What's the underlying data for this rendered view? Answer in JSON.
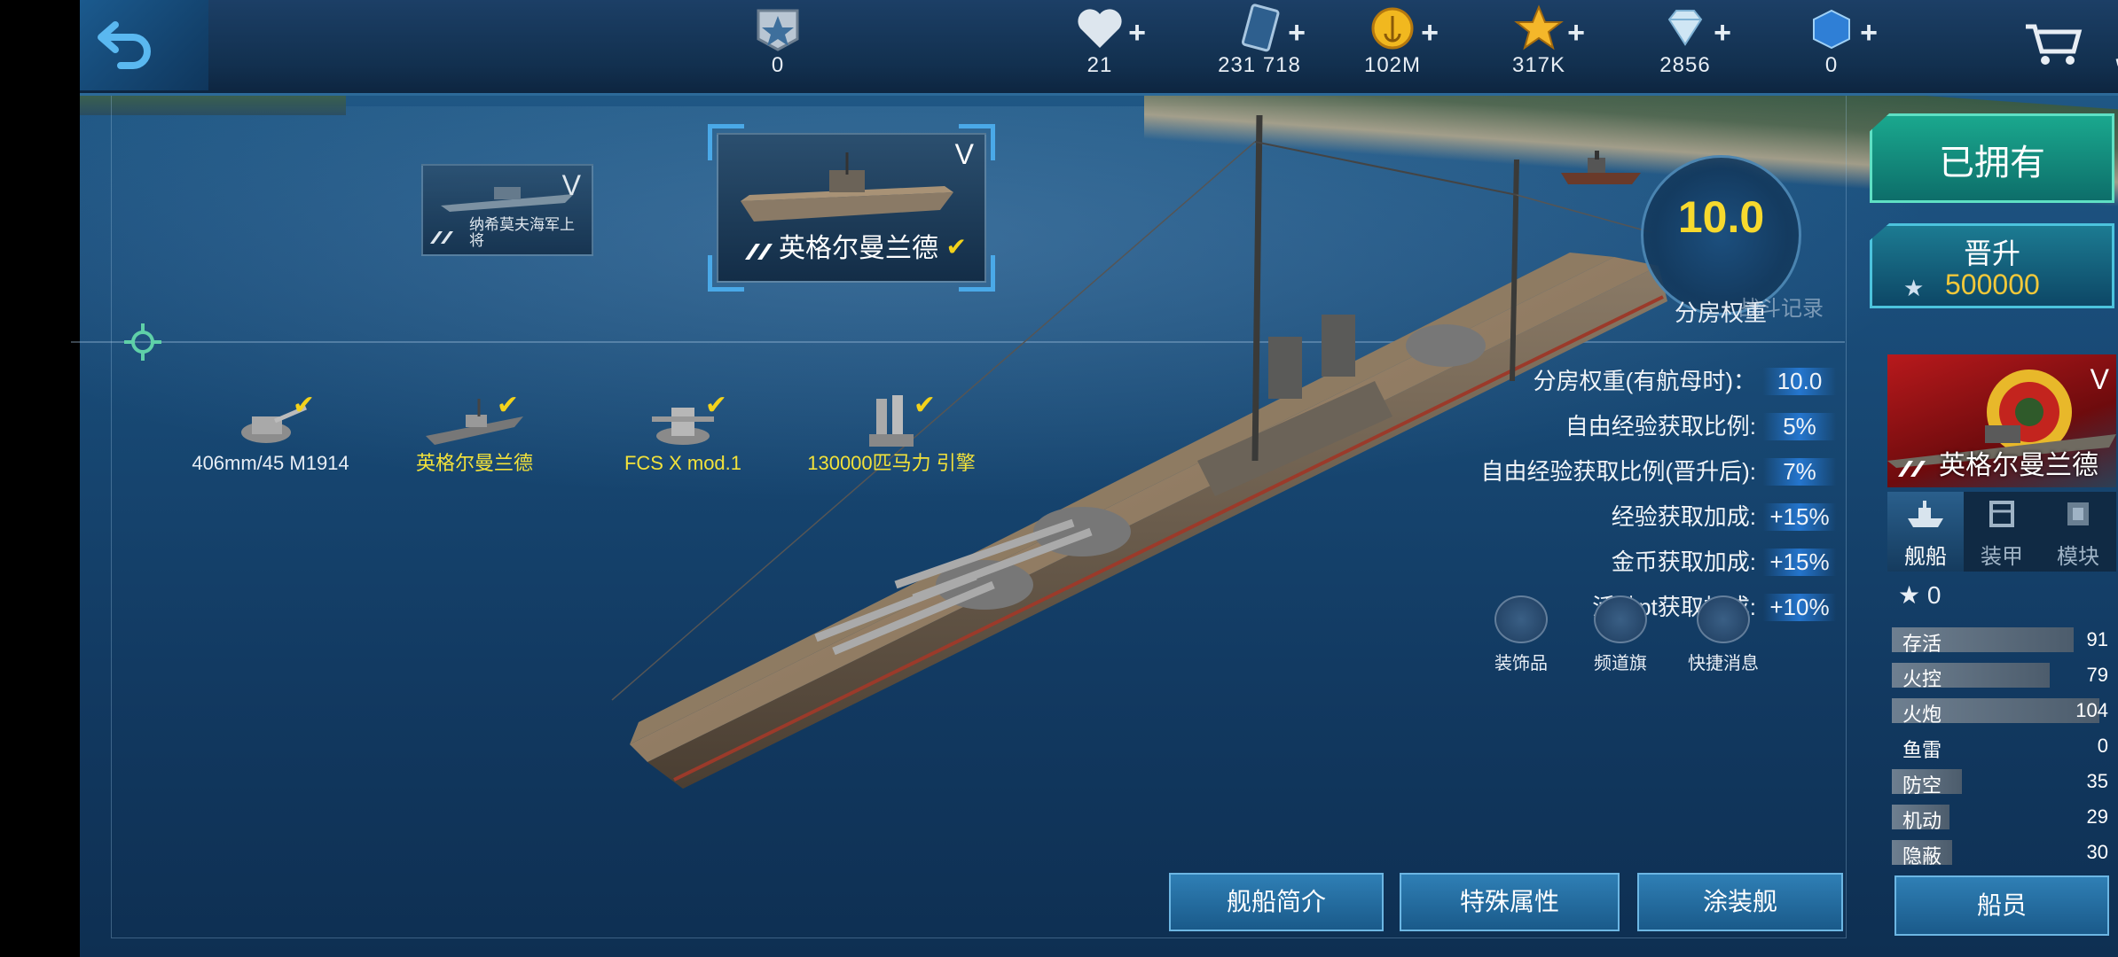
{
  "topbar": {
    "rank_value": "0",
    "resources": [
      {
        "icon": "heart-icon",
        "value": "21"
      },
      {
        "icon": "card-icon",
        "value": "231 718"
      },
      {
        "icon": "gold-coin-icon",
        "value": "102M"
      },
      {
        "icon": "star-icon",
        "value": "317K"
      },
      {
        "icon": "diamond-icon",
        "value": "2856"
      },
      {
        "icon": "blue-cube-icon",
        "value": "0"
      }
    ],
    "plus": "+"
  },
  "ship_cards": {
    "small": {
      "tier": "V",
      "name": "纳希莫夫海军上将"
    },
    "selected": {
      "tier": "V",
      "name": "英格尔曼兰德"
    }
  },
  "modules": [
    {
      "label": "406mm/45 M1914",
      "color": "white"
    },
    {
      "label": "英格尔曼兰德",
      "color": "yellow"
    },
    {
      "label": "FCS X mod.1",
      "color": "yellow"
    },
    {
      "label": "130000匹马力 引擎",
      "color": "yellow"
    }
  ],
  "rating": {
    "value": "10.0",
    "label": "分房权重",
    "record": "战斗记录"
  },
  "stats": [
    {
      "label": "分房权重(有航母时)：",
      "value": "10.0"
    },
    {
      "label": "自由经验获取比例:",
      "value": "5%"
    },
    {
      "label": "自由经验获取比例(晋升后):",
      "value": "7%"
    },
    {
      "label": "经验获取加成:",
      "value": "+15%"
    },
    {
      "label": "金币获取加成:",
      "value": "+15%"
    },
    {
      "label": "活动pt获取加成:",
      "value": "+10%"
    }
  ],
  "social": [
    {
      "label": "装饰品",
      "icon": "flag-icon"
    },
    {
      "label": "频道旗",
      "icon": "pennant-icon"
    },
    {
      "label": "快捷消息",
      "icon": "chat-icon"
    }
  ],
  "bottom_buttons": [
    "舰船简介",
    "特殊属性",
    "涂装舰"
  ],
  "right_panel": {
    "owned": "已拥有",
    "promote": "晋升",
    "promote_cost": "500000",
    "ship_tier": "V",
    "ship_name": "英格尔曼兰德",
    "tabs": [
      {
        "label": "舰船",
        "icon": "ship-icon",
        "active": true
      },
      {
        "label": "装甲",
        "icon": "armor-icon",
        "active": false
      },
      {
        "label": "模块",
        "icon": "module-icon",
        "active": false
      }
    ],
    "stars": "0",
    "attributes": [
      {
        "name": "存活",
        "value": 91
      },
      {
        "name": "火控",
        "value": 79
      },
      {
        "name": "火炮",
        "value": 104
      },
      {
        "name": "鱼雷",
        "value": 0
      },
      {
        "name": "防空",
        "value": 35
      },
      {
        "name": "机动",
        "value": 29
      },
      {
        "name": "隐蔽",
        "value": 30
      }
    ],
    "attribute_max": 110,
    "crew": "船员"
  },
  "colors": {
    "accent": "#4aa9e8",
    "gold": "#f7d92e",
    "owned": "#1aa88e",
    "portrait_red": "#b8191c"
  }
}
